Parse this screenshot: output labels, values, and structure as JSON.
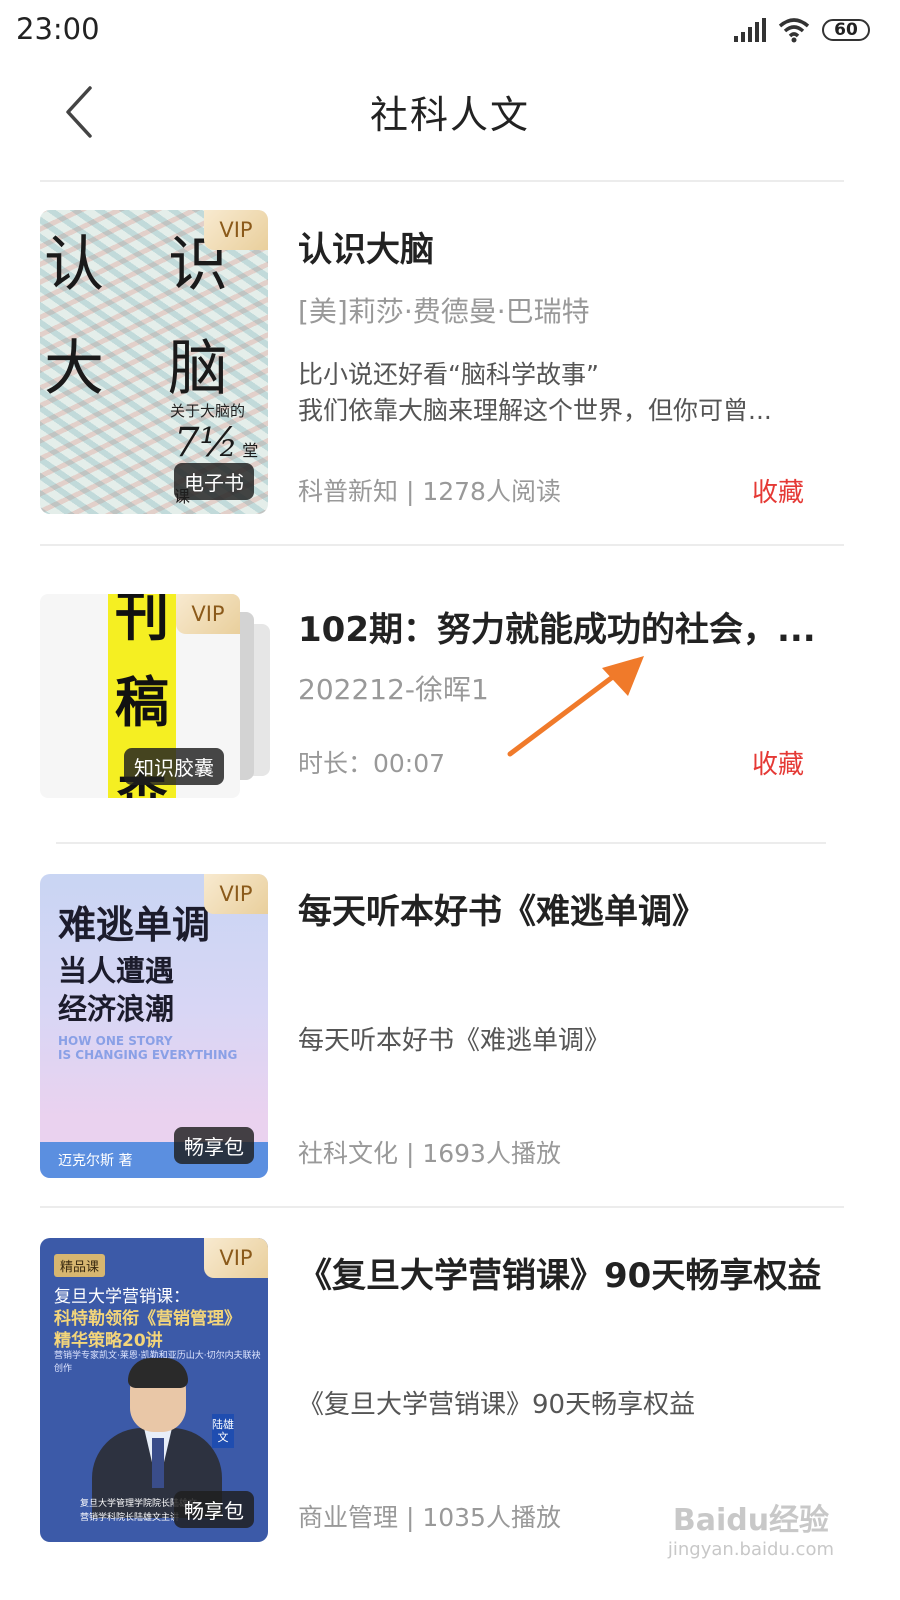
{
  "status_bar": {
    "time": "23:00",
    "battery": "60"
  },
  "header": {
    "title": "社科人文"
  },
  "items": [
    {
      "title": "认识大脑",
      "author": "[美]莉莎·费德曼·巴瑞特",
      "desc_line1": "比小说还好看“脑科学故事”",
      "desc_line2": "我们依靠大脑来理解这个世界，但你可曾...",
      "meta": "科普新知 | 1278人阅读",
      "fav_label": "收藏",
      "vip": "VIP",
      "tag": "电子书",
      "cover": {
        "char1": "认",
        "char2": "识",
        "char3": "大",
        "char4": "脑",
        "subtitle": "关于大脑的",
        "number": "7½",
        "lesson": "堂课"
      }
    },
    {
      "title": "102期：努力就能成功的社会，...",
      "subtitle": "202212-徐晖1",
      "meta": "时长：00:07",
      "fav_label": "收藏",
      "vip": "VIP",
      "tag": "知识胶囊",
      "cover": {
        "char1": "刊",
        "char2": "稿",
        "char3": "森"
      }
    },
    {
      "title": "每天听本好书《难逃单调》",
      "desc": "每天听本好书《难逃单调》",
      "meta": "社科文化 | 1693人播放",
      "vip": "VIP",
      "tag": "畅享包",
      "cover": {
        "title": "难逃单调",
        "line1": "当人遭遇",
        "line2": "经济浪潮",
        "en1": "HOW ONE STORY",
        "en2": "IS CHANGING EVERYTHING",
        "author": "迈克尔斯 著"
      }
    },
    {
      "title": "《复旦大学营销课》90天畅享权益",
      "desc": "《复旦大学营销课》90天畅享权益",
      "meta": "商业管理 | 1035人播放",
      "vip": "VIP",
      "tag": "畅享包",
      "cover": {
        "badge": "精品课",
        "line1": "复旦大学营销课：",
        "line2": "科特勒领衔《营销管理》",
        "line3": "精华策略20讲",
        "small": "营销学专家凯文·莱恩·凯勒和亚历山大·切尔内夫联袂创作",
        "name": "陆雄文",
        "foot1": "复旦大学管理学院院长陆雄文",
        "foot2": "营销学科院长陆雄文主讲"
      }
    }
  ],
  "watermark": {
    "main": "Baidu经验",
    "sub": "jingyan.baidu.com"
  },
  "colors": {
    "accent": "#e53935",
    "arrow": "#f07a2a"
  }
}
